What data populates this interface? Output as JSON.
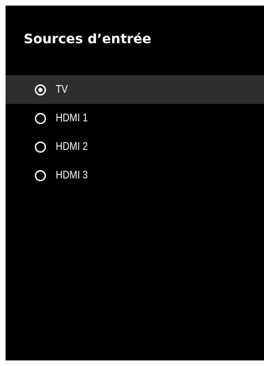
{
  "panel": {
    "title": "Sources d’entrée"
  },
  "inputs": {
    "selected_index": 0,
    "items": [
      {
        "label": "TV",
        "selected": true
      },
      {
        "label": "HDMI 1",
        "selected": false
      },
      {
        "label": "HDMI 2",
        "selected": false
      },
      {
        "label": "HDMI 3",
        "selected": false
      }
    ]
  },
  "colors": {
    "background": "#000000",
    "selected_row": "#2e2e2e",
    "text": "#ffffff"
  }
}
